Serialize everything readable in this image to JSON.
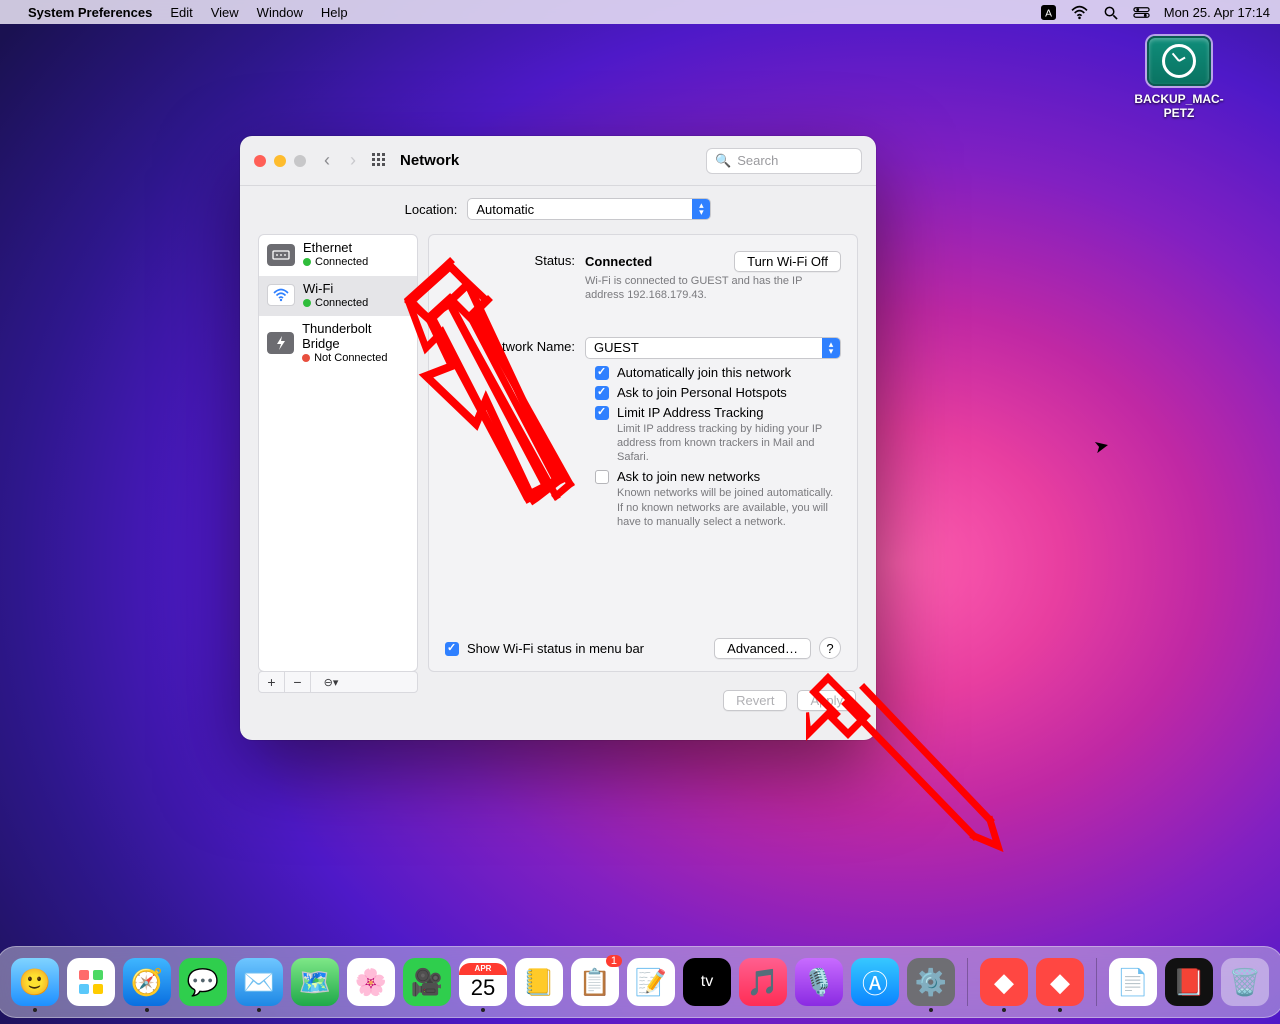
{
  "menubar": {
    "app_name": "System Preferences",
    "menus": [
      "Edit",
      "View",
      "Window",
      "Help"
    ],
    "date_time": "Mon 25. Apr  17:14"
  },
  "desktop": {
    "disk_label": "BACKUP_MAC-PETZ"
  },
  "titlebar": {
    "title": "Network",
    "search_placeholder": "Search"
  },
  "location": {
    "label": "Location:",
    "value": "Automatic"
  },
  "sidebar": {
    "items": [
      {
        "name": "Ethernet",
        "status": "Connected",
        "color": "green"
      },
      {
        "name": "Wi-Fi",
        "status": "Connected",
        "color": "green"
      },
      {
        "name": "Thunderbolt Bridge",
        "status": "Not Connected",
        "color": "red"
      }
    ]
  },
  "panel": {
    "status_label": "Status:",
    "status_value": "Connected",
    "wifi_off_btn": "Turn Wi-Fi Off",
    "status_hint": "Wi-Fi is connected to GUEST and has the IP address 192.168.179.43.",
    "network_name_label": "Network Name:",
    "network_name_value": "GUEST",
    "auto_join": "Automatically join this network",
    "ask_hotspot": "Ask to join Personal Hotspots",
    "limit_ip": "Limit IP Address Tracking",
    "limit_ip_hint": "Limit IP address tracking by hiding your IP address from known trackers in Mail and Safari.",
    "ask_new": "Ask to join new networks",
    "ask_new_hint": "Known networks will be joined automatically. If no known networks are available, you will have to manually select a network.",
    "show_status_menu": "Show Wi-Fi status in menu bar",
    "advanced_btn": "Advanced…",
    "help": "?"
  },
  "footer": {
    "revert": "Revert",
    "apply": "Apply"
  },
  "dock": {
    "calendar_month": "APR",
    "calendar_day": "25",
    "reminders_badge": "1"
  }
}
